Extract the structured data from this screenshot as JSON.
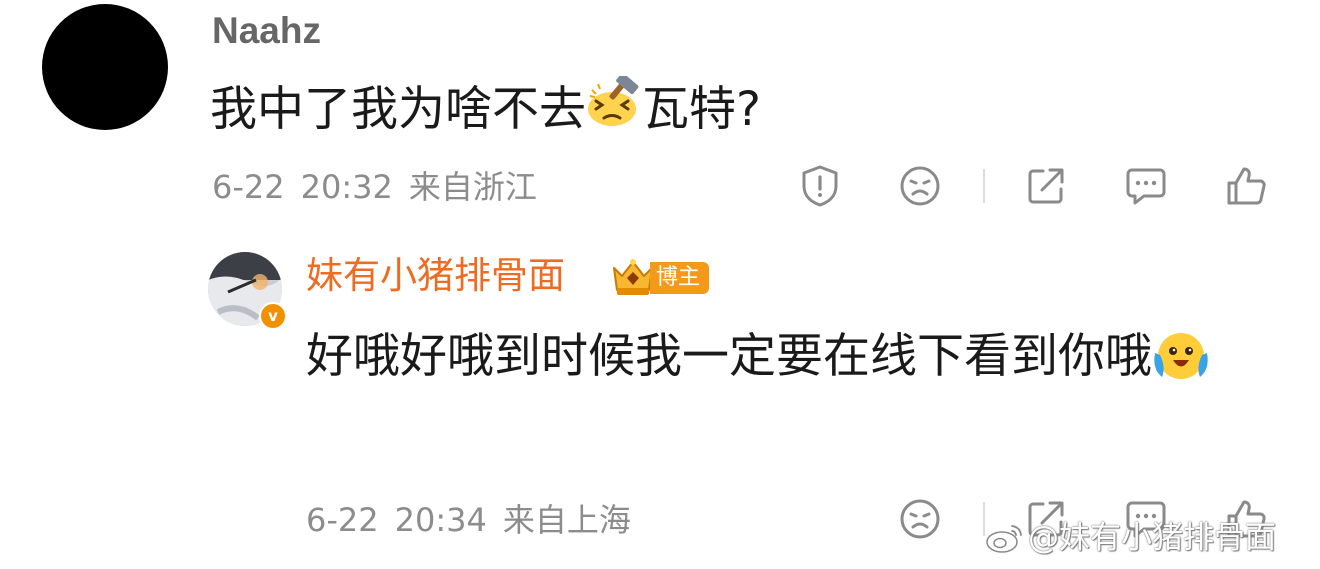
{
  "comment": {
    "username": "Naahz",
    "text_before": "我中了我为啥不去",
    "emoji": "hammer-face-emoji",
    "text_after": "瓦特?",
    "date": "6-22",
    "time": "20:32",
    "location": "来自浙江"
  },
  "reply": {
    "username": "妹有小猪排骨面",
    "badge_label": "博主",
    "verified_mark": "v",
    "text": "好哦好哦到时候我一定要在线下看到你哦",
    "emoji": "joyful-tears-emoji",
    "date": "6-22",
    "time": "20:34",
    "location": "来自上海"
  },
  "watermark": {
    "text": "@妹有小猪排骨面"
  },
  "colors": {
    "username_gray": "#666666",
    "author_orange": "#ee6c22",
    "meta_gray": "#8c8c8c",
    "icon_gray": "#8a8a8a",
    "badge_orange": "#f39a1b"
  },
  "icons": [
    "report-icon",
    "dislike-icon",
    "share-icon",
    "comment-icon",
    "like-icon"
  ]
}
